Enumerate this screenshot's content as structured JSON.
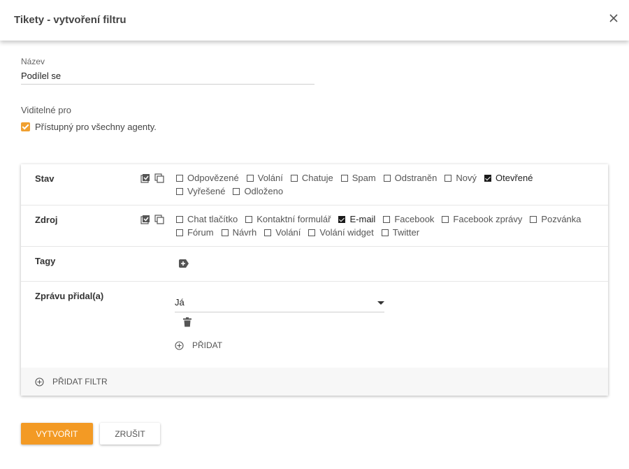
{
  "dialog": {
    "title": "Tikety - vytvoření filtru"
  },
  "form": {
    "name_label": "Název",
    "name_value": "Podílel se",
    "visible_label": "Viditelné pro",
    "visible_option": "Přístupný pro všechny agenty.",
    "visible_checked": true
  },
  "filters": {
    "stav": {
      "label": "Stav",
      "options": [
        {
          "label": "Odpovězené",
          "checked": false
        },
        {
          "label": "Volání",
          "checked": false
        },
        {
          "label": "Chatuje",
          "checked": false
        },
        {
          "label": "Spam",
          "checked": false
        },
        {
          "label": "Odstraněn",
          "checked": false
        },
        {
          "label": "Nový",
          "checked": false
        },
        {
          "label": "Otevřené",
          "checked": true
        },
        {
          "label": "Vyřešené",
          "checked": false
        },
        {
          "label": "Odloženo",
          "checked": false
        }
      ]
    },
    "zdroj": {
      "label": "Zdroj",
      "options": [
        {
          "label": "Chat tlačítko",
          "checked": false
        },
        {
          "label": "Kontaktní formulář",
          "checked": false
        },
        {
          "label": "E-mail",
          "checked": true
        },
        {
          "label": "Facebook",
          "checked": false
        },
        {
          "label": "Facebook zprávy",
          "checked": false
        },
        {
          "label": "Pozvánka",
          "checked": false
        },
        {
          "label": "Fórum",
          "checked": false
        },
        {
          "label": "Návrh",
          "checked": false
        },
        {
          "label": "Volání",
          "checked": false
        },
        {
          "label": "Volání widget",
          "checked": false
        },
        {
          "label": "Twitter",
          "checked": false
        }
      ]
    },
    "tagy": {
      "label": "Tagy"
    },
    "author": {
      "label": "Zprávu přidal(a)",
      "selected": "Já",
      "add_label": "PŘIDAT"
    },
    "add_filter_label": "PŘIDAT FILTR"
  },
  "actions": {
    "create_label": "VYTVOŘIT",
    "cancel_label": "ZRUŠIT"
  },
  "colors": {
    "accent": "#f39a24",
    "checkbox": "#1a1a1a"
  }
}
